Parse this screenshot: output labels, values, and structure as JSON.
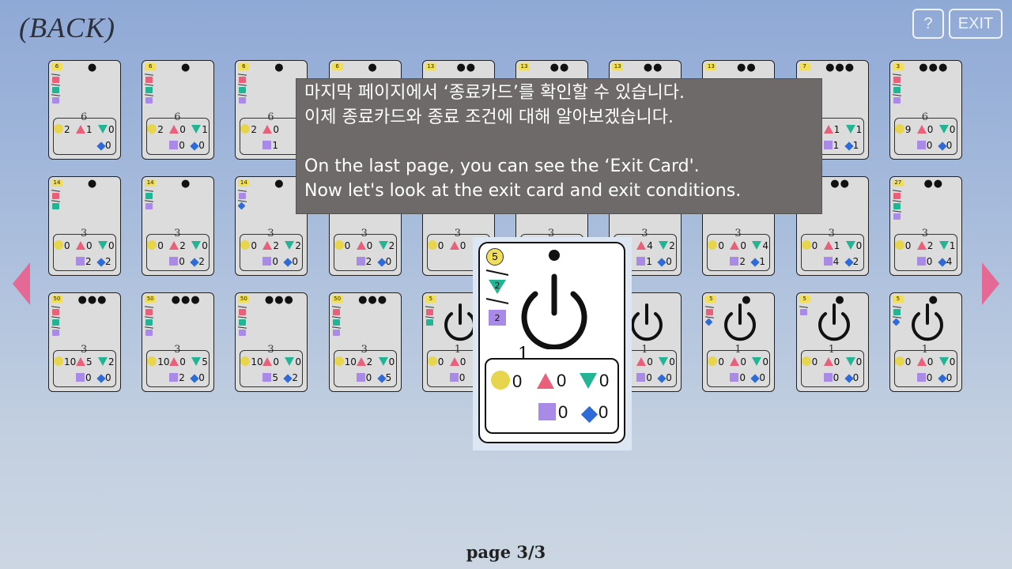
{
  "nav": {
    "back_label": "(BACK)",
    "help_label": "?",
    "exit_label": "EXIT"
  },
  "overlay": {
    "line1": "마지막 페이지에서 ‘종료카드’를 확인할 수 있습니다.",
    "line2": "이제 종료카드와 종료 조건에 대해 알아보겠습니다.",
    "line3": "On the last page, you can see the ‘Exit Card'.",
    "line4": "Now let's look at the exit card and exit conditions."
  },
  "page_indicator": "page 3/3",
  "colors": {
    "circle": "#e8d54e",
    "triangle_up": "#e8607a",
    "triangle_down": "#23b495",
    "square": "#a98ae6",
    "diamond": "#2d6bd8",
    "arrows": "#e46a95"
  },
  "cards": [
    {
      "row": 0,
      "col": 0,
      "badge": "6",
      "dots": "●",
      "chain": [
        "t_up",
        "t_dn",
        "sq"
      ],
      "big": "6",
      "circle": "2",
      "tri_up": "1",
      "tri_dn": "0",
      "square": "",
      "diamond": "0"
    },
    {
      "row": 0,
      "col": 1,
      "badge": "6",
      "dots": "●",
      "chain": [
        "t_up",
        "t_dn",
        "sq"
      ],
      "big": "6",
      "circle": "2",
      "tri_up": "0",
      "tri_dn": "1",
      "square": "0",
      "diamond": "0"
    },
    {
      "row": 0,
      "col": 2,
      "badge": "6",
      "dots": "●",
      "chain": [
        "t_up",
        "t_dn",
        "sq"
      ],
      "big": "6",
      "circle": "2",
      "tri_up": "0",
      "tri_dn": "",
      "square": "1",
      "diamond": ""
    },
    {
      "row": 0,
      "col": 3,
      "badge": "6",
      "dots": "●",
      "chain": [],
      "big": "",
      "circle": "",
      "tri_up": "",
      "tri_dn": "",
      "square": "",
      "diamond": ""
    },
    {
      "row": 0,
      "col": 4,
      "badge": "13",
      "dots": "●●",
      "chain": [],
      "big": "",
      "circle": "",
      "tri_up": "",
      "tri_dn": "",
      "square": "",
      "diamond": ""
    },
    {
      "row": 0,
      "col": 5,
      "badge": "13",
      "dots": "●●",
      "chain": [],
      "big": "",
      "circle": "",
      "tri_up": "",
      "tri_dn": "",
      "square": "",
      "diamond": ""
    },
    {
      "row": 0,
      "col": 6,
      "badge": "13",
      "dots": "●●",
      "chain": [],
      "big": "",
      "circle": "",
      "tri_up": "",
      "tri_dn": "",
      "square": "",
      "diamond": ""
    },
    {
      "row": 0,
      "col": 7,
      "badge": "13",
      "dots": "●●",
      "chain": [],
      "big": "",
      "circle": "",
      "tri_up": "",
      "tri_dn": "",
      "square": "",
      "diamond": ""
    },
    {
      "row": 0,
      "col": 8,
      "badge": "7",
      "dots": "●●●",
      "chain": [],
      "big": "",
      "circle": "",
      "tri_up": "1",
      "tri_dn": "1",
      "square": "1",
      "diamond": "1"
    },
    {
      "row": 0,
      "col": 9,
      "badge": "3",
      "dots": "●●●",
      "chain": [
        "t_up",
        "t_dn",
        "sq"
      ],
      "big": "6",
      "circle": "9",
      "tri_up": "0",
      "tri_dn": "0",
      "square": "0",
      "diamond": "0"
    },
    {
      "row": 1,
      "col": 0,
      "badge": "14",
      "dots": "●",
      "chain": [
        "t_up",
        "t_dn"
      ],
      "big": "3",
      "circle": "0",
      "tri_up": "0",
      "tri_dn": "0",
      "square": "2",
      "diamond": "2"
    },
    {
      "row": 1,
      "col": 1,
      "badge": "14",
      "dots": "●",
      "chain": [
        "t_dn",
        "sq"
      ],
      "big": "3",
      "circle": "0",
      "tri_up": "2",
      "tri_dn": "0",
      "square": "0",
      "diamond": "2"
    },
    {
      "row": 1,
      "col": 2,
      "badge": "14",
      "dots": "●",
      "chain": [
        "sq",
        "dia"
      ],
      "big": "3",
      "circle": "0",
      "tri_up": "2",
      "tri_dn": "2",
      "square": "0",
      "diamond": "0"
    },
    {
      "row": 1,
      "col": 3,
      "badge": "",
      "dots": "",
      "chain": [],
      "big": "3",
      "circle": "0",
      "tri_up": "0",
      "tri_dn": "2",
      "square": "2",
      "diamond": "0"
    },
    {
      "row": 1,
      "col": 4,
      "badge": "",
      "dots": "",
      "chain": [],
      "big": "3",
      "circle": "0",
      "tri_up": "0",
      "tri_dn": "",
      "square": "",
      "diamond": ""
    },
    {
      "row": 1,
      "col": 5,
      "badge": "",
      "dots": "",
      "chain": [],
      "big": "3",
      "circle": "",
      "tri_up": "",
      "tri_dn": "",
      "square": "",
      "diamond": ""
    },
    {
      "row": 1,
      "col": 6,
      "badge": "",
      "dots": "",
      "chain": [
        "dia"
      ],
      "big": "3",
      "circle": "0",
      "tri_up": "4",
      "tri_dn": "2",
      "square": "1",
      "diamond": "0"
    },
    {
      "row": 1,
      "col": 7,
      "badge": "",
      "dots": "",
      "chain": [
        "dia"
      ],
      "big": "3",
      "circle": "0",
      "tri_up": "0",
      "tri_dn": "4",
      "square": "2",
      "diamond": "1"
    },
    {
      "row": 1,
      "col": 8,
      "badge": "",
      "dots": "●●",
      "chain": [
        "dia"
      ],
      "big": "3",
      "circle": "0",
      "tri_up": "1",
      "tri_dn": "0",
      "square": "4",
      "diamond": "2"
    },
    {
      "row": 1,
      "col": 9,
      "badge": "27",
      "dots": "●●",
      "chain": [
        "t_up",
        "t_dn",
        "sq"
      ],
      "big": "3",
      "circle": "0",
      "tri_up": "2",
      "tri_dn": "1",
      "square": "0",
      "diamond": "4"
    },
    {
      "row": 2,
      "col": 0,
      "badge": "50",
      "dots": "●●●",
      "chain": [
        "t_up",
        "t_dn",
        "sq"
      ],
      "big": "3",
      "circle": "10",
      "tri_up": "5",
      "tri_dn": "2",
      "square": "0",
      "diamond": "0"
    },
    {
      "row": 2,
      "col": 1,
      "badge": "50",
      "dots": "●●●",
      "chain": [
        "t_up",
        "t_dn",
        "sq"
      ],
      "big": "3",
      "circle": "10",
      "tri_up": "0",
      "tri_dn": "5",
      "square": "2",
      "diamond": "0"
    },
    {
      "row": 2,
      "col": 2,
      "badge": "50",
      "dots": "●●●",
      "chain": [
        "t_up",
        "t_dn",
        "sq"
      ],
      "big": "3",
      "circle": "10",
      "tri_up": "0",
      "tri_dn": "0",
      "square": "5",
      "diamond": "2"
    },
    {
      "row": 2,
      "col": 3,
      "badge": "50",
      "dots": "●●●",
      "chain": [
        "t_up",
        "t_dn",
        "sq"
      ],
      "big": "3",
      "circle": "10",
      "tri_up": "2",
      "tri_dn": "0",
      "square": "0",
      "diamond": "5"
    },
    {
      "row": 2,
      "col": 4,
      "badge": "5",
      "dots": "",
      "chain": [
        "t_up",
        "t_dn"
      ],
      "power": true,
      "big": "1",
      "circle": "0",
      "tri_up": "0",
      "tri_dn": "",
      "square": "0",
      "diamond": ""
    },
    {
      "row": 2,
      "col": 5,
      "badge": "",
      "dots": "",
      "chain": [],
      "power": true,
      "big": "1",
      "circle": "",
      "tri_up": "",
      "tri_dn": "",
      "square": "",
      "diamond": ""
    },
    {
      "row": 2,
      "col": 6,
      "badge": "",
      "dots": "",
      "chain": [],
      "power": true,
      "big": "1",
      "circle": "0",
      "tri_up": "0",
      "tri_dn": "0",
      "square": "0",
      "diamond": "0"
    },
    {
      "row": 2,
      "col": 7,
      "badge": "5",
      "dots": "●",
      "chain": [
        "t_up",
        "dia"
      ],
      "power": true,
      "big": "1",
      "circle": "0",
      "tri_up": "0",
      "tri_dn": "0",
      "square": "0",
      "diamond": "0"
    },
    {
      "row": 2,
      "col": 8,
      "badge": "5",
      "dots": "●",
      "chain": [
        "sq"
      ],
      "power": true,
      "big": "1",
      "circle": "0",
      "tri_up": "0",
      "tri_dn": "0",
      "square": "0",
      "diamond": "0"
    },
    {
      "row": 2,
      "col": 9,
      "badge": "5",
      "dots": "●",
      "chain": [
        "t_dn",
        "dia"
      ],
      "power": true,
      "big": "1",
      "circle": "0",
      "tri_up": "0",
      "tri_dn": "0",
      "square": "0",
      "diamond": "0"
    }
  ],
  "zoom_card": {
    "badge": "5",
    "chain_tri_dn": "2",
    "chain_square": "2",
    "big": "1",
    "circle": "0",
    "tri_up": "0",
    "tri_dn": "0",
    "square": "0",
    "diamond": "0"
  }
}
